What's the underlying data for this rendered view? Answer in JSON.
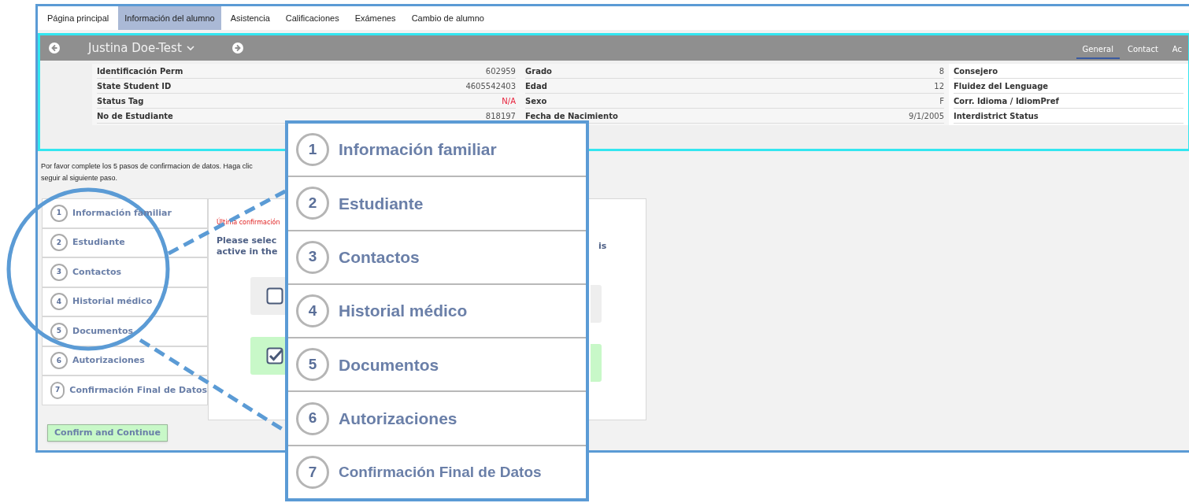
{
  "tabs": [
    {
      "label": "Página principal",
      "selected": false
    },
    {
      "label": "Información del alumno",
      "selected": true
    },
    {
      "label": "Asistencia",
      "selected": false
    },
    {
      "label": "Calificaciones",
      "selected": false
    },
    {
      "label": "Exámenes",
      "selected": false
    },
    {
      "label": "Cambio de alumno",
      "selected": false
    }
  ],
  "header": {
    "student_name": "Justina Doe-Test",
    "sub_tabs": [
      {
        "label": "General",
        "selected": true
      },
      {
        "label": "Contact",
        "selected": false
      },
      {
        "label": "Ac",
        "selected": false
      }
    ]
  },
  "info_columns": [
    {
      "rows": [
        {
          "label": "Identificación Perm",
          "value": "602959",
          "kind": "normal"
        },
        {
          "label": "State Student ID",
          "value": "4605542403",
          "kind": "normal"
        },
        {
          "label": "Status Tag",
          "value": "N/A",
          "kind": "alert"
        },
        {
          "label": "No de Estudiante",
          "value": "818197",
          "kind": "normal"
        }
      ]
    },
    {
      "rows": [
        {
          "label": "Grado",
          "value": "8",
          "kind": "normal"
        },
        {
          "label": "Edad",
          "value": "12",
          "kind": "normal"
        },
        {
          "label": "Sexo",
          "value": "F",
          "kind": "normal"
        },
        {
          "label": "Fecha de Nacimiento",
          "value": "9/1/2005",
          "kind": "normal"
        }
      ]
    },
    {
      "rows": [
        {
          "label": "Consejero"
        },
        {
          "label": "Fluidez del Lenguage"
        },
        {
          "label": "Corr. Idioma / IdiomPref"
        },
        {
          "label": "Interdistrict Status"
        }
      ]
    }
  ],
  "instructions": [
    "Por favor complete los 5 pasos de confirmacion de datos. Haga clic",
    "seguir al siguiente paso."
  ],
  "steps": [
    {
      "number": "1",
      "label": "Información familiar"
    },
    {
      "number": "2",
      "label": "Estudiante"
    },
    {
      "number": "3",
      "label": "Contactos"
    },
    {
      "number": "4",
      "label": "Historial médico"
    },
    {
      "number": "5",
      "label": "Documentos"
    },
    {
      "number": "6",
      "label": "Autorizaciones"
    },
    {
      "number": "7",
      "label": "Confirmación Final de Datos"
    }
  ],
  "panel": {
    "notice": "Última confirmación",
    "prompt_lines": [
      "Please selec",
      "active in the"
    ],
    "prompt_tail": "is",
    "options": [
      {
        "checked": false
      },
      {
        "checked": true
      }
    ]
  },
  "confirm_button": "Confirm and Continue",
  "callout_steps": [
    {
      "number": "1",
      "label": "Información familiar"
    },
    {
      "number": "2",
      "label": "Estudiante"
    },
    {
      "number": "3",
      "label": "Contactos"
    },
    {
      "number": "4",
      "label": "Historial médico"
    },
    {
      "number": "5",
      "label": "Documentos"
    },
    {
      "number": "6",
      "label": "Autorizaciones"
    },
    {
      "number": "7",
      "label": "Confirmación Final de Datos"
    }
  ]
}
